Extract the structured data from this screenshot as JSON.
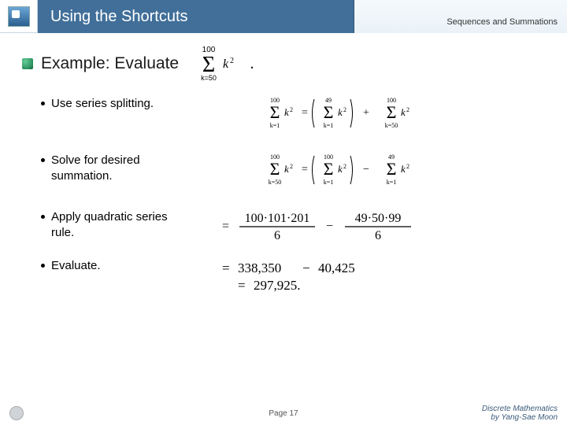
{
  "header": {
    "title": "Using the Shortcuts",
    "chapter": "Sequences and Summations"
  },
  "example": {
    "label": "Example: Evaluate",
    "sum_lower": "k=50",
    "sum_upper": "100",
    "sum_term": "k²",
    "period": "."
  },
  "steps": [
    {
      "text": "Use series splitting."
    },
    {
      "text": "Solve for desired summation."
    },
    {
      "text": "Apply quadratic series rule."
    },
    {
      "text": "Evaluate."
    }
  ],
  "math": {
    "split": {
      "lhs": {
        "lower": "k=1",
        "upper": "100",
        "term": "k²"
      },
      "rhs1": {
        "lower": "k=1",
        "upper": "49",
        "term": "k²"
      },
      "rhs2": {
        "lower": "k=50",
        "upper": "100",
        "term": "k²"
      },
      "op": "+"
    },
    "solve": {
      "lhs": {
        "lower": "k=50",
        "upper": "100",
        "term": "k²"
      },
      "rhs1": {
        "lower": "k=1",
        "upper": "100",
        "term": "k²"
      },
      "rhs2": {
        "lower": "k=1",
        "upper": "49",
        "term": "k²"
      },
      "op": "−"
    },
    "rule": {
      "num1": "100·101·201",
      "den1": "6",
      "num2": "49·50·99",
      "den2": "6",
      "op": "−"
    },
    "eval1": {
      "a": "338,350",
      "b": "40,425",
      "op": "−"
    },
    "eval2": "297,925."
  },
  "footer": {
    "page": "Page 17",
    "credit_line1": "Discrete Mathematics",
    "credit_line2": "by Yang-Sae Moon"
  }
}
